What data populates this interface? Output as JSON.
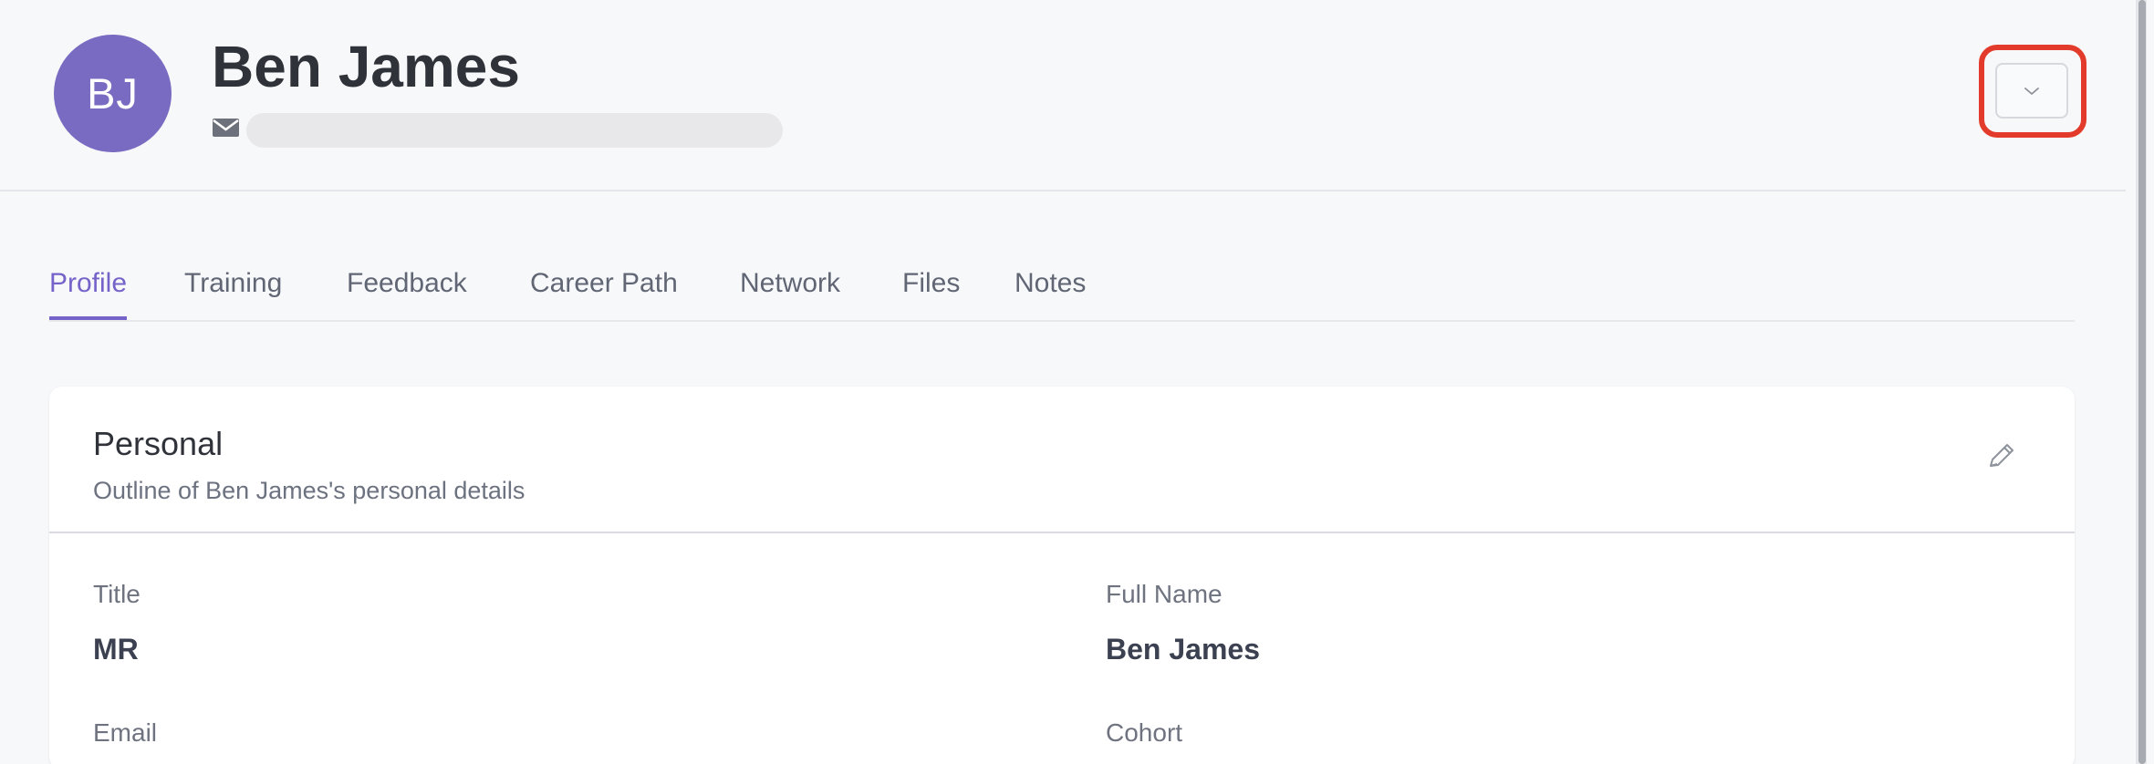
{
  "header": {
    "avatar_initials": "BJ",
    "name": "Ben James",
    "email_icon": "mail-icon",
    "email_value": "",
    "dropdown_icon": "chevron-down-icon"
  },
  "tabs": [
    {
      "label": "Profile",
      "active": true
    },
    {
      "label": "Training",
      "active": false
    },
    {
      "label": "Feedback",
      "active": false
    },
    {
      "label": "Career Path",
      "active": false
    },
    {
      "label": "Network",
      "active": false
    },
    {
      "label": "Files",
      "active": false
    },
    {
      "label": "Notes",
      "active": false
    }
  ],
  "personal": {
    "title": "Personal",
    "subtitle": "Outline of Ben James's personal details",
    "edit_icon": "pencil-icon",
    "fields": {
      "title_label": "Title",
      "title_value": "MR",
      "full_name_label": "Full Name",
      "full_name_value": "Ben James",
      "email_label": "Email",
      "cohort_label": "Cohort"
    }
  },
  "colors": {
    "accent": "#7563c9",
    "avatar": "#7a6bc2",
    "highlight": "#e33b2b"
  }
}
